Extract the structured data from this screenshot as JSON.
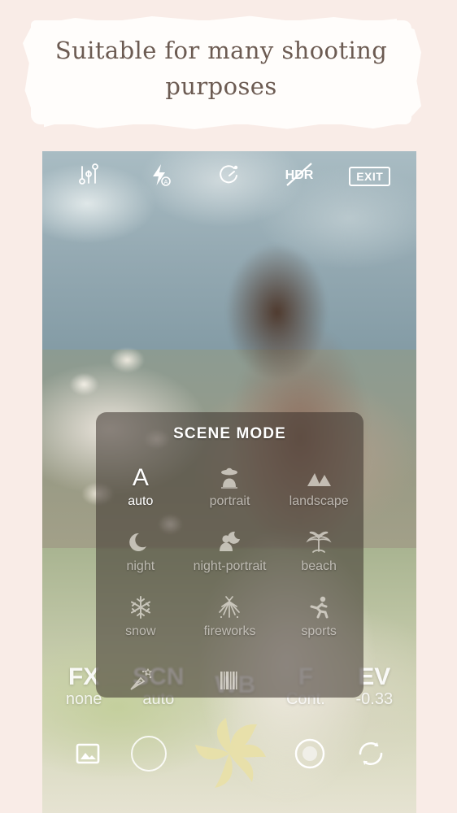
{
  "promo": {
    "headline_line1": "Suitable for many shooting",
    "headline_line2": "purposes",
    "text_color": "#6c5b52",
    "banner_color": "#fffdfb",
    "page_background": "#f9ece7"
  },
  "camera": {
    "toolbar": [
      {
        "name": "settings-sliders",
        "label": ""
      },
      {
        "name": "flash-auto",
        "label": "A"
      },
      {
        "name": "timer",
        "label": ""
      },
      {
        "name": "hdr-off",
        "label": "HDR"
      },
      {
        "name": "exit",
        "label": "EXIT"
      }
    ],
    "mode_bar": [
      {
        "key": "FX",
        "value": "none"
      },
      {
        "key": "SCN",
        "value": "auto"
      },
      {
        "key": "WB",
        "value": ""
      },
      {
        "key": "F",
        "value": "Cont."
      },
      {
        "key": "EV",
        "value": "-0.33"
      }
    ],
    "bottom_controls": [
      {
        "name": "gallery",
        "label": ""
      },
      {
        "name": "mode-ring",
        "label": ""
      },
      {
        "name": "shutter",
        "label": ""
      },
      {
        "name": "record",
        "label": ""
      },
      {
        "name": "switch-camera",
        "label": ""
      }
    ],
    "shutter_color": "#ece3ab"
  },
  "scene_dialog": {
    "title": "SCENE MODE",
    "background": "rgba(58,50,44,0.55)",
    "items": [
      {
        "label": "auto",
        "icon": "letter-a-icon",
        "selected": true
      },
      {
        "label": "portrait",
        "icon": "portrait-icon",
        "selected": false
      },
      {
        "label": "landscape",
        "icon": "landscape-icon",
        "selected": false
      },
      {
        "label": "night",
        "icon": "moon-icon",
        "selected": false
      },
      {
        "label": "night-portrait",
        "icon": "night-portrait-icon",
        "selected": false
      },
      {
        "label": "beach",
        "icon": "palm-tree-icon",
        "selected": false
      },
      {
        "label": "snow",
        "icon": "snowflake-icon",
        "selected": false
      },
      {
        "label": "fireworks",
        "icon": "fireworks-icon",
        "selected": false
      },
      {
        "label": "sports",
        "icon": "runner-icon",
        "selected": false
      },
      {
        "label": "",
        "icon": "party-popper-icon",
        "selected": false
      },
      {
        "label": "",
        "icon": "barcode-icon",
        "selected": false
      },
      {
        "label": "",
        "icon": "",
        "selected": false
      }
    ]
  }
}
